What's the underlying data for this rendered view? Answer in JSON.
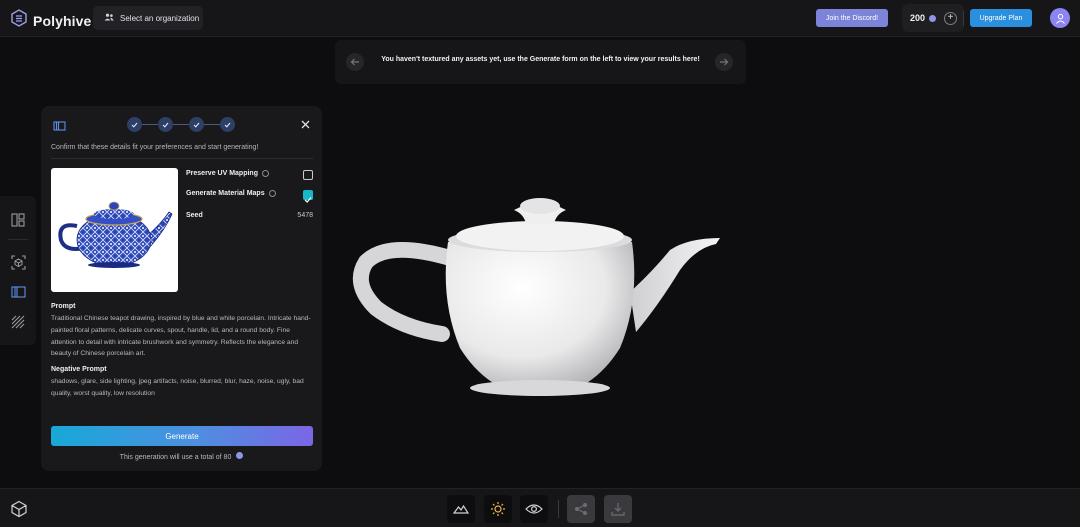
{
  "header": {
    "brand": "Polyhive",
    "org_button": "Select an organization",
    "discord_button": "Join the Discord!",
    "credits": "200",
    "upgrade_button": "Upgrade Plan"
  },
  "notice": {
    "text": "You haven't textured any assets yet, use the Generate form on the left to view your results here!"
  },
  "panel": {
    "confirm_text": "Confirm that these details fit your preferences and start generating!",
    "options": {
      "preserve_uv": {
        "label": "Preserve UV Mapping",
        "checked": false
      },
      "material_maps": {
        "label": "Generate Material Maps",
        "checked": true
      }
    },
    "seed": {
      "label": "Seed",
      "value": "5478"
    },
    "prompt": {
      "title": "Prompt",
      "text": "Traditional Chinese teapot drawing, inspired by blue and white porcelain. Intricate hand-painted floral patterns, delicate curves, spout, handle, lid, and a round body. Fine attention to detail with intricate brushwork and symmetry. Reflects the elegance and beauty of Chinese porcelain art."
    },
    "negative_prompt": {
      "title": "Negative Prompt",
      "text": "shadows, glare, side lighting, jpeg artifacts, noise, blurred, blur, haze, noise, ugly, bad quality, worst quality, low resolution"
    },
    "generate_button": "Generate",
    "generation_note": "This generation will use a total of 80"
  },
  "colors": {
    "accent": "#2b8fe0",
    "discord": "#7b84d8",
    "checkbox_on": "#19b6c8",
    "step": "#2e3f66"
  }
}
